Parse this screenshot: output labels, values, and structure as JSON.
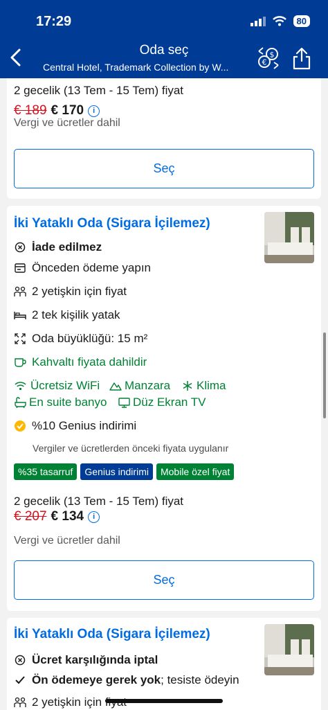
{
  "status": {
    "time": "17:29",
    "battery": "80"
  },
  "header": {
    "title": "Oda seç",
    "subtitle": "Central Hotel, Trademark Collection by W..."
  },
  "card1": {
    "price_line": "2 gecelik (13 Tem - 15 Tem) fiyat",
    "old_price": "€ 189",
    "new_price": "€ 170",
    "tax": "Vergi ve ücretler dahil",
    "button": "Seç"
  },
  "card2": {
    "title": "İki Yataklı Oda (Sigara İçilemez)",
    "features": [
      {
        "icon": "non-refundable-icon",
        "text": "İade edilmez"
      },
      {
        "icon": "card-icon",
        "text": "Önceden ödeme yapın"
      },
      {
        "icon": "people-icon",
        "text": "2 yetişkin için fiyat"
      },
      {
        "icon": "bed-icon",
        "text": "2 tek kişilik yatak"
      },
      {
        "icon": "size-icon",
        "text": "Oda büyüklüğü: 15 m²"
      },
      {
        "icon": "coffee-icon",
        "text": "Kahvaltı fiyata dahildir"
      }
    ],
    "amenities": [
      {
        "icon": "wifi-icon",
        "text": "Ücretsiz WiFi"
      },
      {
        "icon": "mountain-icon",
        "text": "Manzara"
      },
      {
        "icon": "snowflake-icon",
        "text": "Klima"
      },
      {
        "icon": "bath-icon",
        "text": "En suite banyo"
      },
      {
        "icon": "tv-icon",
        "text": "Düz Ekran TV"
      }
    ],
    "genius": "%10 Genius indirimi",
    "genius_note": "Vergiler ve ücretlerden önceki fiyata uygulanır",
    "badges": [
      {
        "text": "%35 tasarruf",
        "color": "#008234"
      },
      {
        "text": "Genius indirimi",
        "color": "#003b95"
      },
      {
        "text": "Mobile özel fiyat",
        "color": "#008234"
      }
    ],
    "price_line": "2 gecelik (13 Tem - 15 Tem) fiyat",
    "old_price": "€ 207",
    "new_price": "€ 134",
    "tax": "Vergi ve ücretler dahil",
    "button": "Seç"
  },
  "card3": {
    "title": "İki Yataklı Oda (Sigara İçilemez)",
    "cancel": "Ücret karşılığında iptal",
    "prepay_bold": "Ön ödemeye gerek yok",
    "prepay_rest": "; tesiste ödeyin",
    "people": "2 yetişkin için fiyat"
  },
  "colors": {
    "brand": "#003b95",
    "link": "#006ce4",
    "green": "#008234",
    "red": "#d4111e"
  }
}
